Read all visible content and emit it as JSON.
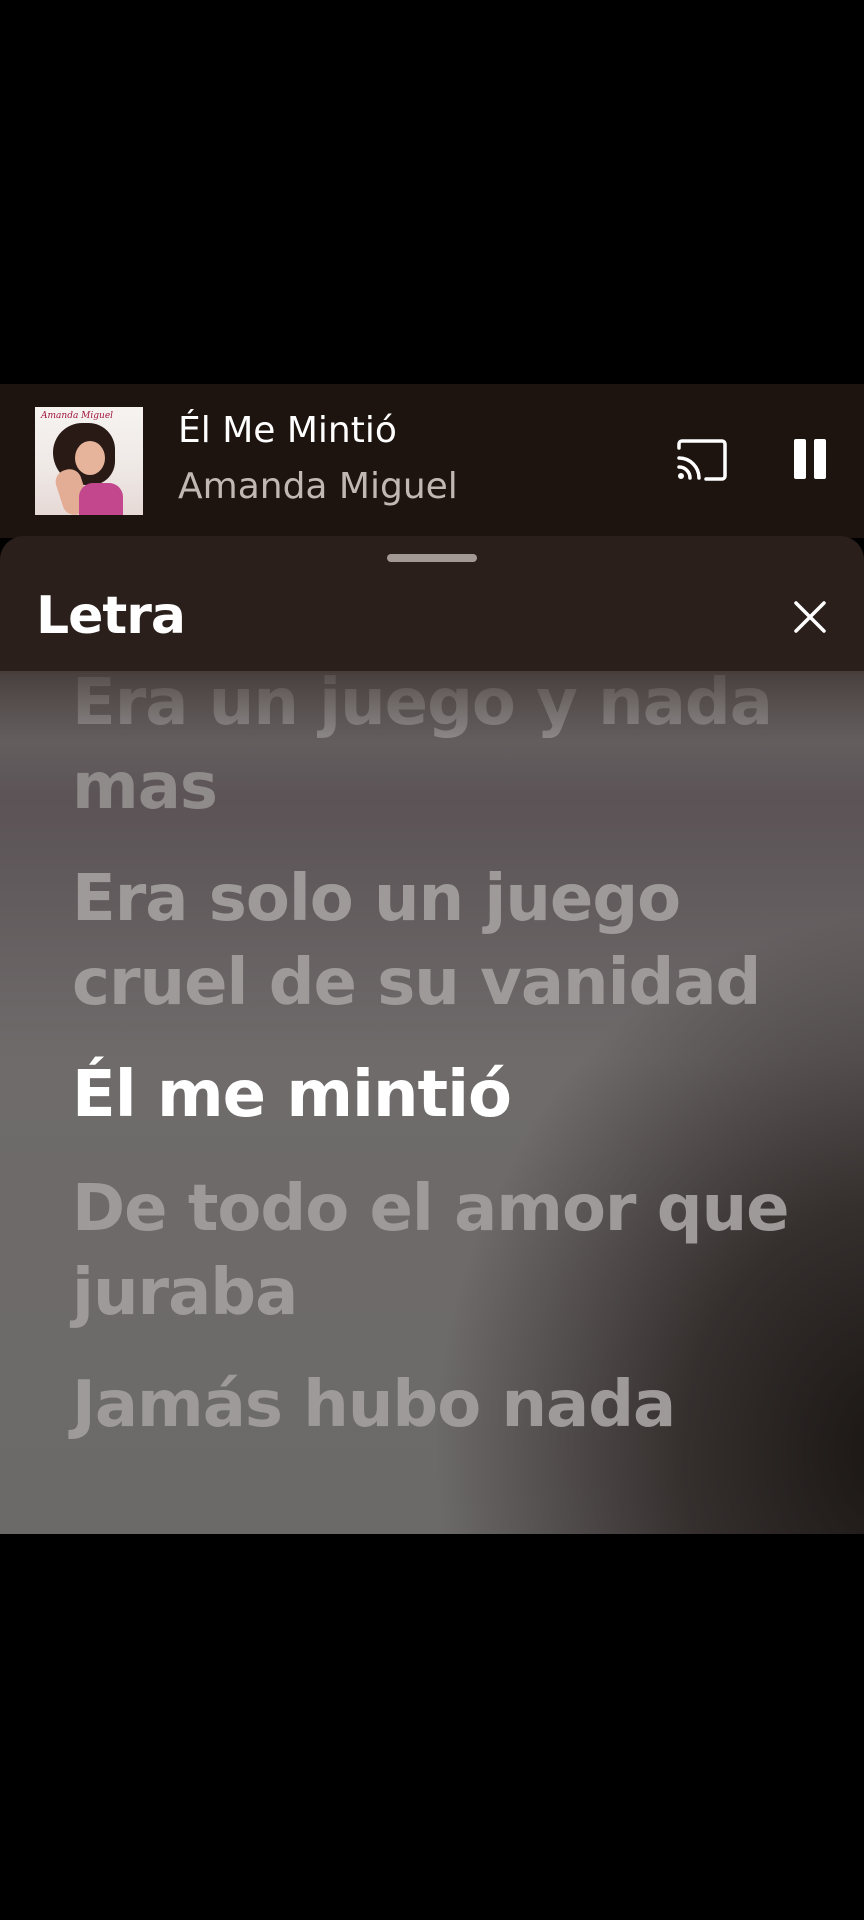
{
  "now_playing": {
    "title": "Él Me Mintió",
    "artist": "Amanda Miguel",
    "album_art_text": "Amanda Miguel"
  },
  "lyrics_sheet": {
    "title": "Letra",
    "lines": [
      "Era un juego y nada\nmas",
      "Era solo un juego\ncruel de su vanidad",
      "Él me mintió",
      "De todo el amor que\njuraba",
      "Jamás hubo nada"
    ],
    "active_line_index": 2
  },
  "icons": {
    "cast": "cast-icon",
    "pause": "pause-icon",
    "close": "close-icon"
  },
  "colors": {
    "active_lyric": "#ffffff",
    "inactive_lyric": "#9d9a99",
    "header_bg": "#2b1f1b"
  }
}
